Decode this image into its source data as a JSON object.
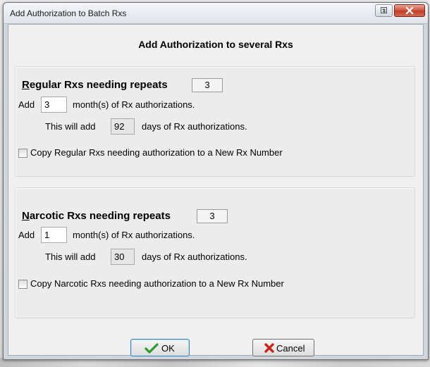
{
  "window": {
    "title": "Add Authorization to Batch Rxs",
    "controls": {
      "restore_icon": "restore-icon",
      "close_icon": "close-icon"
    }
  },
  "dialog": {
    "header": "Add Authorization to several Rxs",
    "regular": {
      "title_mnemonic": "R",
      "title_rest": "egular Rxs needing repeats",
      "count": "3",
      "add_label": "Add",
      "months_value": "3",
      "months_label": "month(s) of Rx authorizations.",
      "will_add_label": "This will add",
      "days_value": "92",
      "days_label": "days of Rx authorizations.",
      "copy_checked": false,
      "copy_label": "Copy Regular Rxs needing authorization to a New Rx Number"
    },
    "narcotic": {
      "title_mnemonic": "N",
      "title_rest": "arcotic Rxs needing repeats",
      "count": "3",
      "add_label": "Add",
      "months_value": "1",
      "months_label": "month(s) of Rx authorizations.",
      "will_add_label": "This will add",
      "days_value": "30",
      "days_label": "days of Rx authorizations.",
      "copy_checked": false,
      "copy_label": "Copy Narcotic Rxs needing authorization to a New Rx Number"
    },
    "buttons": {
      "ok_label": "OK",
      "ok_icon": "checkmark-icon",
      "cancel_label": "Cancel",
      "cancel_icon": "x-mark-icon"
    }
  },
  "colors": {
    "ok_check": "#2e9a2e",
    "cancel_x": "#c8261c",
    "close_button": "#c94f3b"
  }
}
